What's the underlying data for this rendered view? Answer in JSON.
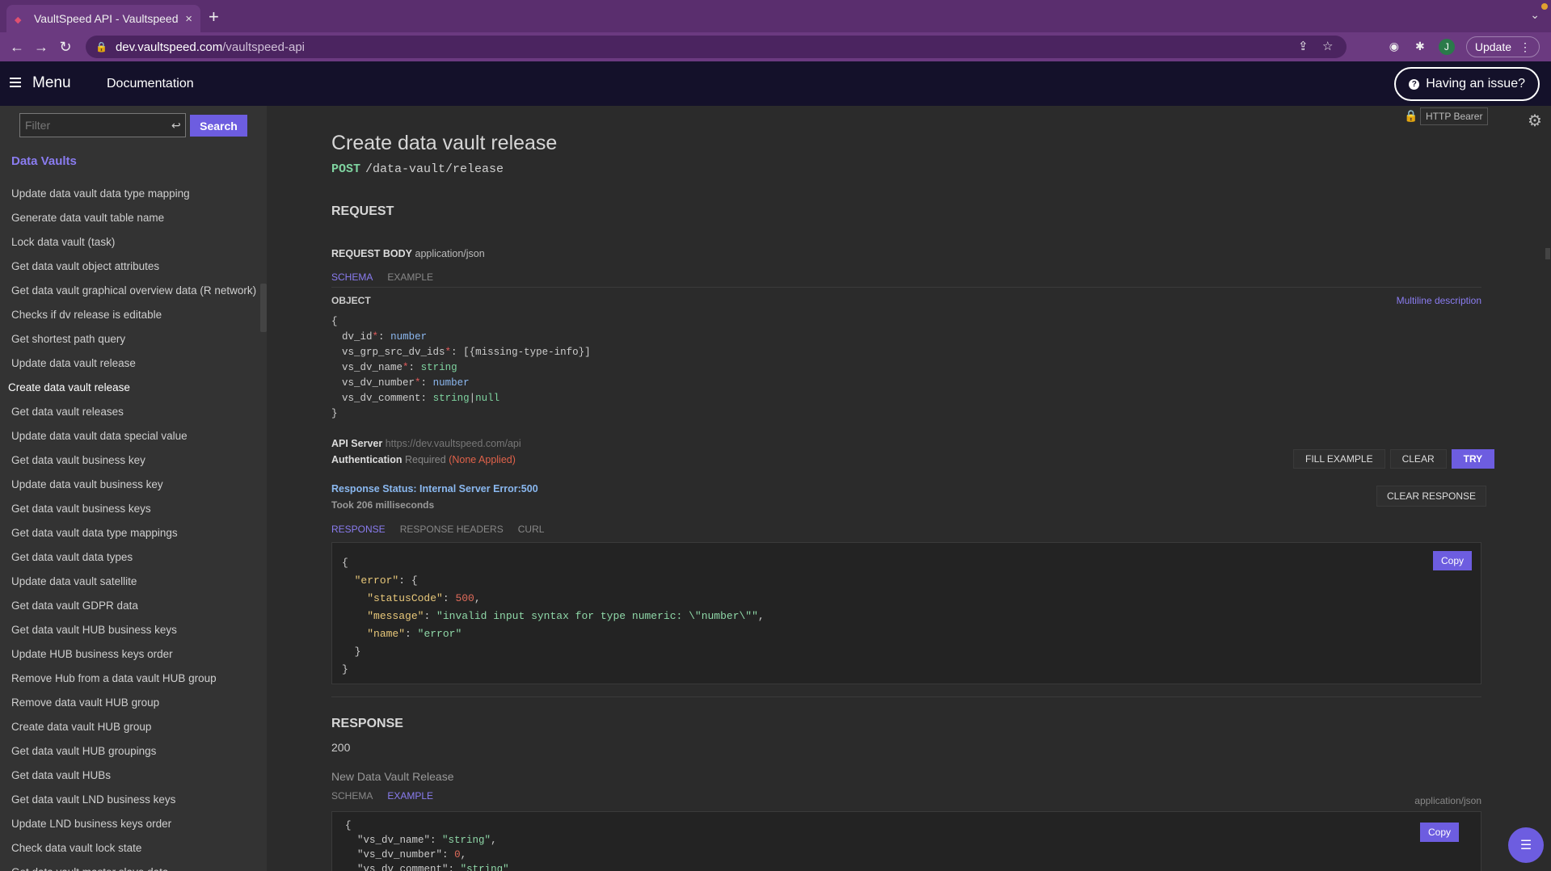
{
  "browser": {
    "tab_title": "VaultSpeed API - Vaultspeed",
    "tab_close": "×",
    "new_tab": "+",
    "url_host": "dev.vaultspeed.com",
    "url_path": "/vaultspeed-api",
    "avatar_initial": "J",
    "update_label": "Update"
  },
  "header": {
    "menu_label": "Menu",
    "documentation_label": "Documentation",
    "issue_button": "Having an issue?"
  },
  "sidebar": {
    "filter_placeholder": "Filter",
    "search_label": "Search",
    "group_title": "Data Vaults",
    "items": [
      "Update data vault data type mapping",
      "Generate data vault table name",
      "Lock data vault (task)",
      "Get data vault object attributes",
      "Get data vault graphical overview data (R network)",
      "Checks if dv release is editable",
      "Get shortest path query",
      "Update data vault release",
      "Create data vault release",
      "Get data vault releases",
      "Update data vault data special value",
      "Get data vault business key",
      "Update data vault business key",
      "Get data vault business keys",
      "Get data vault data type mappings",
      "Get data vault data types",
      "Update data vault satellite",
      "Get data vault GDPR data",
      "Get data vault HUB business keys",
      "Update HUB business keys order",
      "Remove Hub from a data vault HUB group",
      "Remove data vault HUB group",
      "Create data vault HUB group",
      "Get data vault HUB groupings",
      "Get data vault HUBs",
      "Get data vault LND business keys",
      "Update LND business keys order",
      "Check data vault lock state",
      "Get data vault master slave data"
    ],
    "active_index": 8
  },
  "main": {
    "auth_chip": "HTTP Bearer",
    "title": "Create data vault release",
    "method": "POST",
    "path": "/data-vault/release",
    "request_heading": "REQUEST",
    "request_body_label": "REQUEST BODY",
    "request_body_type": "application/json",
    "schema_tab": "SCHEMA",
    "example_tab": "EXAMPLE",
    "object_label": "OBJECT",
    "multiline_link": "Multiline description",
    "schema": {
      "open": "{",
      "close": "}",
      "f1_name": "dv_id",
      "f1_type": "number",
      "f2_name": "vs_grp_src_dv_ids",
      "f2_type": "[{missing-type-info}]",
      "f3_name": "vs_dv_name",
      "f3_type": "string",
      "f4_name": "vs_dv_number",
      "f4_type": "number",
      "f5_name": "vs_dv_comment",
      "f5_type_a": "string",
      "f5_sep": "|",
      "f5_type_b": "null",
      "req_mark": "*",
      "colon": ":"
    },
    "api_server_label": "API Server",
    "api_server_url": "https://dev.vaultspeed.com/api",
    "auth_label": "Authentication",
    "auth_required": "Required",
    "auth_none": "(None Applied)",
    "fill_example": "FILL EXAMPLE",
    "clear": "CLEAR",
    "try": "TRY",
    "response_status": "Response Status: Internal Server Error:500",
    "took": "Took 206 milliseconds",
    "clear_response": "CLEAR RESPONSE",
    "resp_tab_response": "RESPONSE",
    "resp_tab_headers": "RESPONSE HEADERS",
    "resp_tab_curl": "CURL",
    "copy": "Copy",
    "error_json": {
      "l1": "{",
      "k_error": "\"error\"",
      "l2_tail": ": {",
      "k_status": "\"statusCode\"",
      "v_status": "500",
      "k_message": "\"message\"",
      "v_message": "\"invalid input syntax for type numeric: \\\"number\\\"\"",
      "k_name": "\"name\"",
      "v_name": "\"error\"",
      "l_close_inner": "}",
      "l_close": "}"
    },
    "response_heading": "RESPONSE",
    "response_code": "200",
    "response_desc": "New Data Vault Release",
    "response_ctype": "application/json",
    "example_json": {
      "open": "{",
      "k1": "\"vs_dv_name\"",
      "v1": "\"string\"",
      "k2": "\"vs_dv_number\"",
      "v2": "0",
      "k3": "\"vs_dv_comment\"",
      "v3": "\"string\""
    }
  }
}
